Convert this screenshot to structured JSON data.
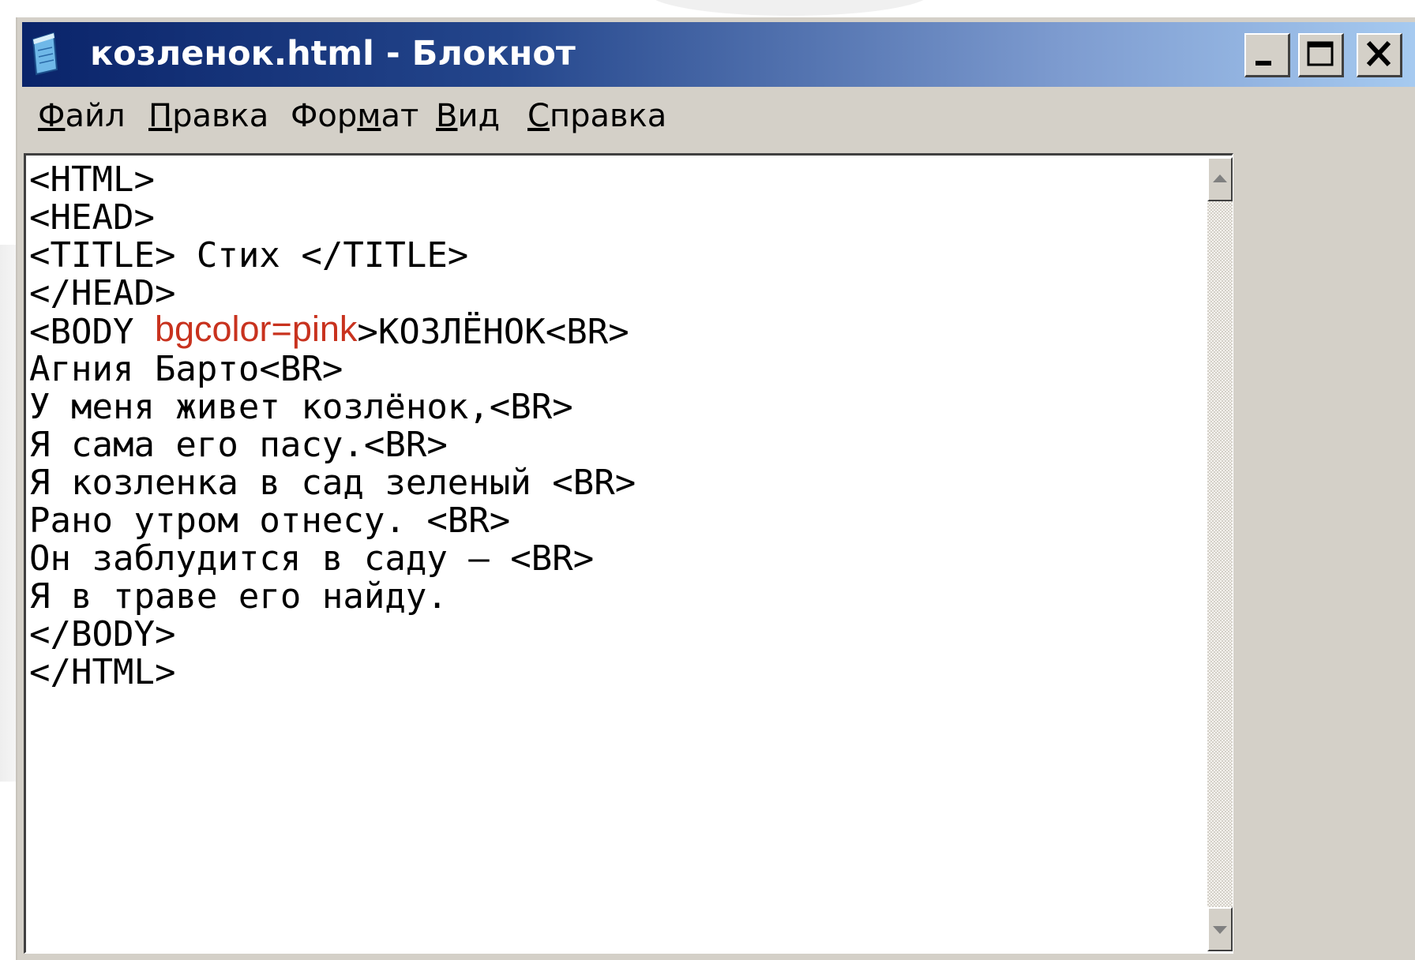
{
  "window": {
    "title": "козленок.html - Блокнот",
    "icon": "notepad-icon",
    "controls": {
      "minimize": "minimize-icon",
      "maximize": "maximize-icon",
      "close": "close-icon"
    }
  },
  "menu": {
    "items": [
      {
        "label": "Файл",
        "mnemonic": "Ф"
      },
      {
        "label": "Правка",
        "mnemonic": "П"
      },
      {
        "label": "Формат",
        "mnemonic": "м"
      },
      {
        "label": "Вид",
        "mnemonic": "В"
      },
      {
        "label": "Справка",
        "mnemonic": "С"
      }
    ]
  },
  "editor": {
    "lines": [
      "<HTML>",
      "<HEAD>",
      "<TITLE> Стих </TITLE>",
      "</HEAD>",
      "<BODY ",
      "Агния Барто<BR>",
      "У меня живет козлёнок,<BR>",
      "Я сама его пасу.<BR>",
      "Я козленка в сад зеленый <BR>",
      "Рано утром отнесу. <BR>",
      "Он заблудится в саду – <BR>",
      "Я в траве его найду.",
      "</BODY>",
      "</HTML>"
    ],
    "body_attribute": "bgcolor=pink",
    "body_rest": ">КОЗЛЁНОК<BR>",
    "attribute_color": "#c8321e"
  },
  "colors": {
    "titlebar_start": "#0a246a",
    "titlebar_end": "#a6caf0",
    "window_face": "#d4d0c8"
  }
}
